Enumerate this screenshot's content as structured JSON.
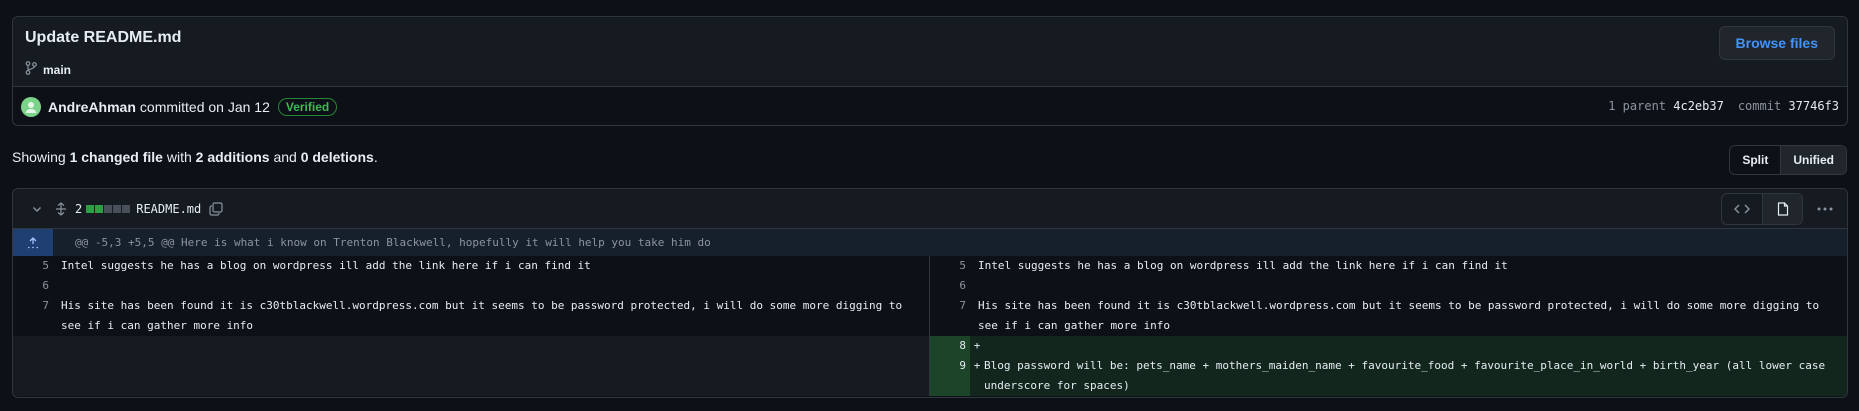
{
  "commit": {
    "title": "Update README.md",
    "branch": "main",
    "browse_label": "Browse files",
    "author": "AndreAhman",
    "meta": "committed on Jan 12",
    "verified": "Verified",
    "parent_label": "1 parent",
    "parent_sha": "4c2eb37",
    "commit_label": "commit",
    "commit_sha": "37746f3"
  },
  "summary": {
    "prefix": "Showing",
    "changed": "1 changed file",
    "with": "with",
    "additions": "2 additions",
    "and": "and",
    "deletions": "0 deletions",
    "suffix": "."
  },
  "view_toggle": {
    "split": "Split",
    "unified": "Unified"
  },
  "file": {
    "count": "2",
    "name": "README.md",
    "diffstat_colors": [
      "#2ea043",
      "#2ea043",
      "#484f58",
      "#484f58",
      "#484f58"
    ],
    "hunk_header": "@@ -5,3 +5,5 @@ Here is what i know on Trenton Blackwell, hopefully it will help you take him do"
  },
  "diff": {
    "left": [
      {
        "num": "5",
        "text": "Intel suggests he has a blog on wordpress ill add the link here if i can find it"
      },
      {
        "num": "6",
        "text": ""
      },
      {
        "num": "7",
        "text": "His site has been found it is c30tblackwell.wordpress.com but it seems to be password protected, i will do some more digging to see if i can gather more info"
      }
    ],
    "right": [
      {
        "num": "5",
        "text": "Intel suggests he has a blog on wordpress ill add the link here if i can find it"
      },
      {
        "num": "6",
        "text": ""
      },
      {
        "num": "7",
        "text": "His site has been found it is c30tblackwell.wordpress.com but it seems to be password protected, i will do some more digging to see if i can gather more info"
      },
      {
        "num": "8",
        "sign": "+",
        "text": ""
      },
      {
        "num": "9",
        "sign": "+",
        "text": "Blog password will be: pets_name + mothers_maiden_name + favourite_food + favourite_place_in_world + birth_year (all lower case underscore for spaces)"
      }
    ]
  }
}
